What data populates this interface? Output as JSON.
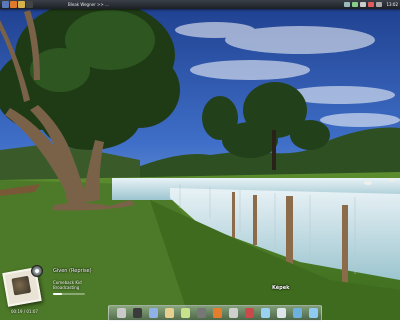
{
  "top_panel": {
    "window_title": "Bleak Wegner >> ...",
    "clock": "13:02"
  },
  "music_widget": {
    "track_title": "Given (Reprise)",
    "track_info": "Comeback Kid Broadcasting",
    "time": "00:19 / 01:07",
    "progress": 0.28
  },
  "dock": {
    "hover_label": "Képek",
    "icons": [
      {
        "name": "user-home-icon",
        "color": "#c9c9c9"
      },
      {
        "name": "terminal-icon",
        "color": "#3b3b3b"
      },
      {
        "name": "files-icon",
        "color": "#8fb1e6"
      },
      {
        "name": "documents-icon",
        "color": "#e6cf8f"
      },
      {
        "name": "notes-icon",
        "color": "#c8e28c"
      },
      {
        "name": "settings-icon",
        "color": "#777777"
      },
      {
        "name": "firefox-icon",
        "color": "#e57e2c"
      },
      {
        "name": "close-icon",
        "color": "#cfcfcf"
      },
      {
        "name": "media-player-icon",
        "color": "#c84a4a"
      },
      {
        "name": "chat-icon",
        "color": "#9ad0f2"
      },
      {
        "name": "pictures-icon",
        "color": "#dfe5ea"
      },
      {
        "name": "world-icon",
        "color": "#6fb1dd"
      },
      {
        "name": "web-browser-icon",
        "color": "#8fcaf0"
      }
    ]
  }
}
